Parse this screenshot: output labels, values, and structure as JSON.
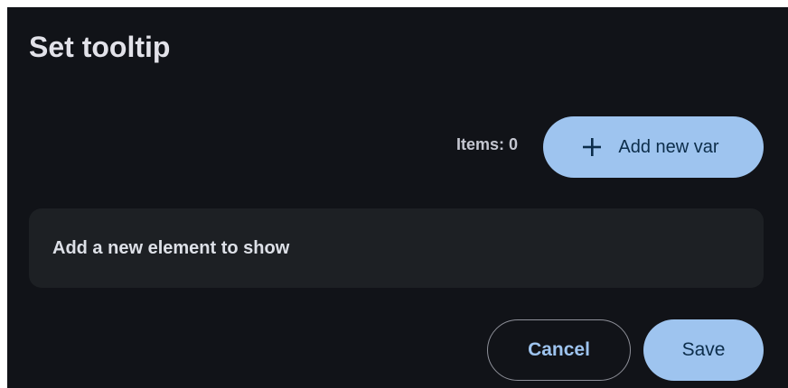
{
  "dialog": {
    "title": "Set tooltip",
    "items_label": "Items: 0",
    "add_button": {
      "label": "Add new var",
      "icon": "plus-icon"
    },
    "empty_message": "Add a new element to show",
    "actions": {
      "cancel_label": "Cancel",
      "save_label": "Save"
    }
  },
  "colors": {
    "background": "#111318",
    "surface": "#1d2024",
    "primary": "#9ec4ef",
    "on_primary": "#0c2d4a",
    "text": "#e2e2e9",
    "outline": "#8e9099"
  }
}
